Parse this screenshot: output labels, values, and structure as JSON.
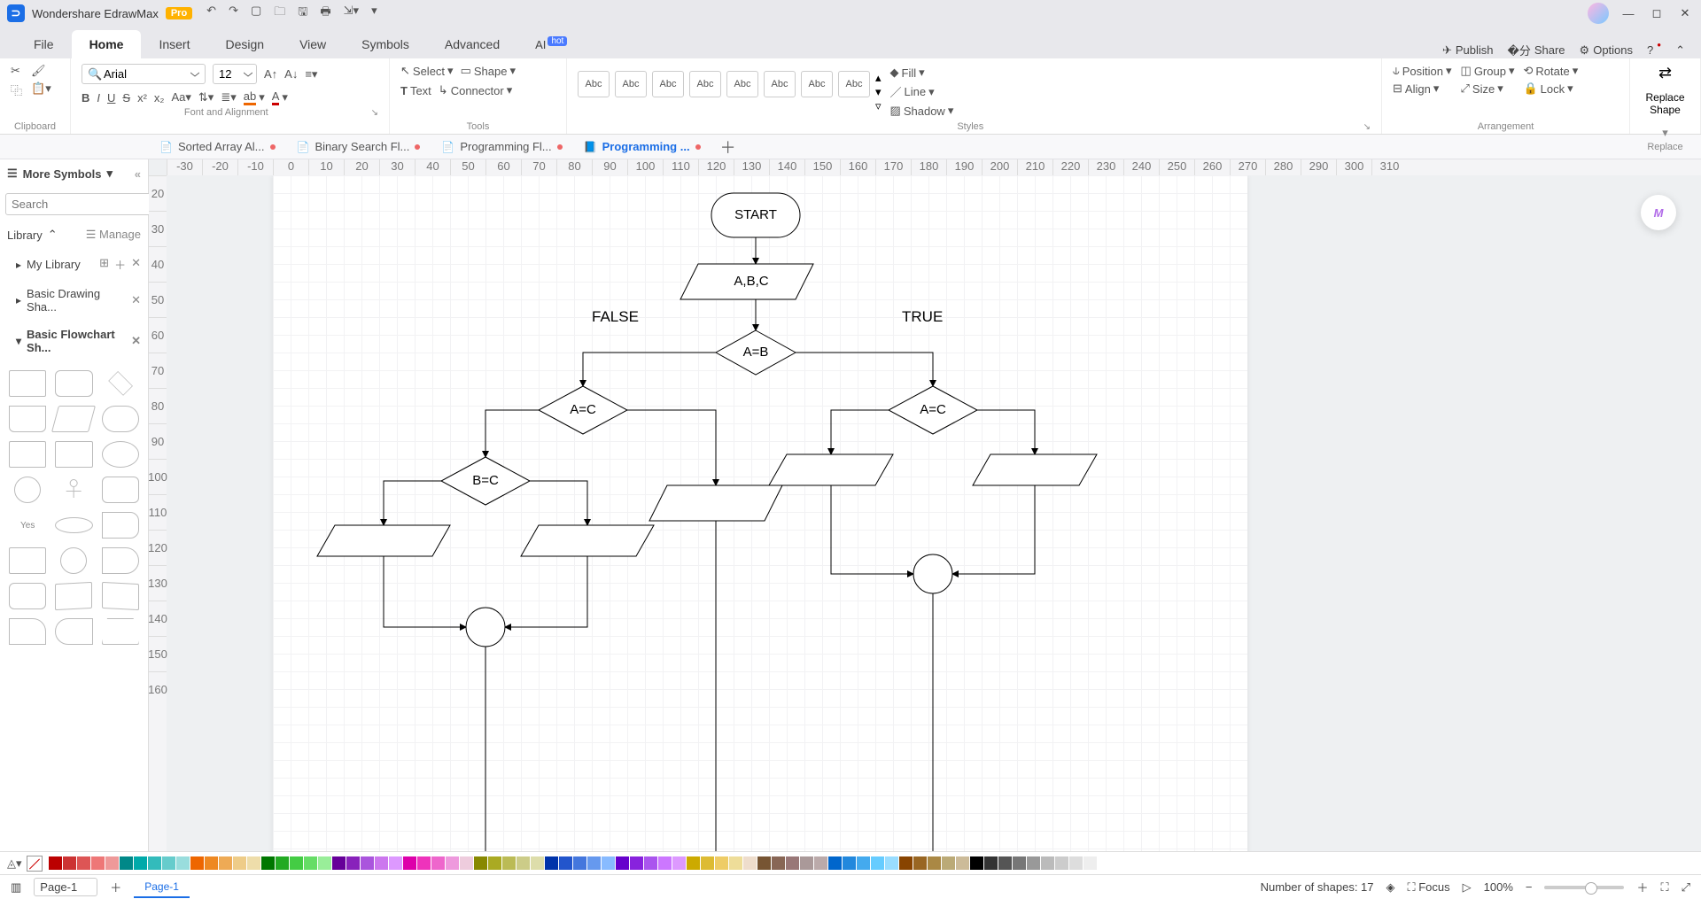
{
  "app": {
    "title": "Wondershare EdrawMax",
    "badge": "Pro"
  },
  "menu": {
    "items": [
      "File",
      "Home",
      "Insert",
      "Design",
      "View",
      "Symbols",
      "Advanced",
      "AI"
    ],
    "active": "Home",
    "hot": "hot",
    "right": {
      "publish": "Publish",
      "share": "Share",
      "options": "Options"
    }
  },
  "ribbon": {
    "font_name": "Arial",
    "font_size": "12",
    "select": "Select",
    "shape": "Shape",
    "text": "Text",
    "connector": "Connector",
    "style_label": "Abc",
    "fill": "Fill",
    "line": "Line",
    "shadow": "Shadow",
    "position": "Position",
    "align": "Align",
    "group": "Group",
    "size": "Size",
    "rotate": "Rotate",
    "lock": "Lock",
    "replace_shape": "Replace Shape",
    "groups": {
      "clipboard": "Clipboard",
      "font": "Font and Alignment",
      "tools": "Tools",
      "styles": "Styles",
      "arrangement": "Arrangement",
      "replace": "Replace"
    }
  },
  "tabs": [
    {
      "name": "Sorted Array Al...",
      "dirty": true
    },
    {
      "name": "Binary Search Fl...",
      "dirty": true
    },
    {
      "name": "Programming Fl...",
      "dirty": true
    },
    {
      "name": "Programming ...",
      "dirty": true,
      "active": true
    }
  ],
  "left": {
    "more_symbols": "More Symbols",
    "search_btn": "Search",
    "search_ph": "Search",
    "library": "Library",
    "manage": "Manage",
    "my_library": "My Library",
    "basic_drawing": "Basic Drawing Sha...",
    "basic_flowchart": "Basic Flowchart Sh..."
  },
  "ruler_h": [
    "-30",
    "-20",
    "-10",
    "0",
    "10",
    "20",
    "30",
    "40",
    "50",
    "60",
    "70",
    "80",
    "90",
    "100",
    "110",
    "120",
    "130",
    "140",
    "150",
    "160",
    "170",
    "180",
    "190",
    "200",
    "210",
    "220",
    "230",
    "240",
    "250",
    "260",
    "270",
    "280",
    "290",
    "300",
    "310"
  ],
  "ruler_v": [
    "20",
    "30",
    "40",
    "50",
    "60",
    "70",
    "80",
    "90",
    "100",
    "110",
    "120",
    "130",
    "140",
    "150",
    "160"
  ],
  "chart_data": {
    "type": "flowchart",
    "nodes": [
      {
        "id": "start",
        "shape": "terminator",
        "label": "START"
      },
      {
        "id": "input",
        "shape": "parallelogram",
        "label": "A,B,C"
      },
      {
        "id": "dAB",
        "shape": "decision",
        "label": "A=B"
      },
      {
        "id": "dAC_L",
        "shape": "decision",
        "label": "A=C"
      },
      {
        "id": "dAC_R",
        "shape": "decision",
        "label": "A=C"
      },
      {
        "id": "dBC",
        "shape": "decision",
        "label": "B=C"
      },
      {
        "id": "o1",
        "shape": "parallelogram",
        "label": ""
      },
      {
        "id": "o2",
        "shape": "parallelogram",
        "label": ""
      },
      {
        "id": "o3",
        "shape": "parallelogram",
        "label": ""
      },
      {
        "id": "o4",
        "shape": "parallelogram",
        "label": ""
      },
      {
        "id": "o5",
        "shape": "parallelogram",
        "label": ""
      },
      {
        "id": "jL",
        "shape": "connector-circle",
        "label": ""
      },
      {
        "id": "jR",
        "shape": "connector-circle",
        "label": ""
      }
    ],
    "edges": [
      {
        "from": "start",
        "to": "input"
      },
      {
        "from": "input",
        "to": "dAB"
      },
      {
        "from": "dAB",
        "to": "dAC_L",
        "label": "FALSE"
      },
      {
        "from": "dAB",
        "to": "dAC_R",
        "label": "TRUE"
      },
      {
        "from": "dAC_L",
        "to": "dBC"
      },
      {
        "from": "dAC_L",
        "to": "o3"
      },
      {
        "from": "dBC",
        "to": "o1"
      },
      {
        "from": "dBC",
        "to": "o2"
      },
      {
        "from": "o1",
        "to": "jL"
      },
      {
        "from": "o2",
        "to": "jL"
      },
      {
        "from": "dAC_R",
        "to": "o4"
      },
      {
        "from": "dAC_R",
        "to": "o5"
      },
      {
        "from": "o4",
        "to": "jR"
      },
      {
        "from": "o5",
        "to": "jR"
      }
    ],
    "labels": {
      "false": "FALSE",
      "true": "TRUE"
    }
  },
  "status": {
    "page_sel": "Page-1",
    "page_tab": "Page-1",
    "shapes": "Number of shapes: 17",
    "focus": "Focus",
    "zoom": "100%"
  },
  "colors": [
    "#b00",
    "#c33",
    "#d55",
    "#e77",
    "#e99",
    "#088",
    "#0aa",
    "#3bb",
    "#6cc",
    "#9dd",
    "#e60",
    "#e82",
    "#ea5",
    "#ec8",
    "#eda",
    "#070",
    "#2a2",
    "#4c4",
    "#6d6",
    "#9e9",
    "#609",
    "#82b",
    "#a5d",
    "#c7e",
    "#d9f",
    "#d0a",
    "#e3b",
    "#e6c",
    "#e9d",
    "#ecd",
    "#880",
    "#aa2",
    "#bb5",
    "#cc8",
    "#dda",
    "#03a",
    "#25c",
    "#47d",
    "#69e",
    "#8bf",
    "#60c",
    "#82d",
    "#a5e",
    "#c7f",
    "#d9f",
    "#ca0",
    "#db3",
    "#ec6",
    "#ed9",
    "#edc",
    "#753",
    "#865",
    "#977",
    "#a99",
    "#baa",
    "#06c",
    "#28d",
    "#4ae",
    "#6cf",
    "#9df",
    "#840",
    "#962",
    "#a84",
    "#ba7",
    "#cb9",
    "#000",
    "#333",
    "#555",
    "#777",
    "#999",
    "#bbb",
    "#ccc",
    "#ddd",
    "#eee",
    "#fff"
  ]
}
